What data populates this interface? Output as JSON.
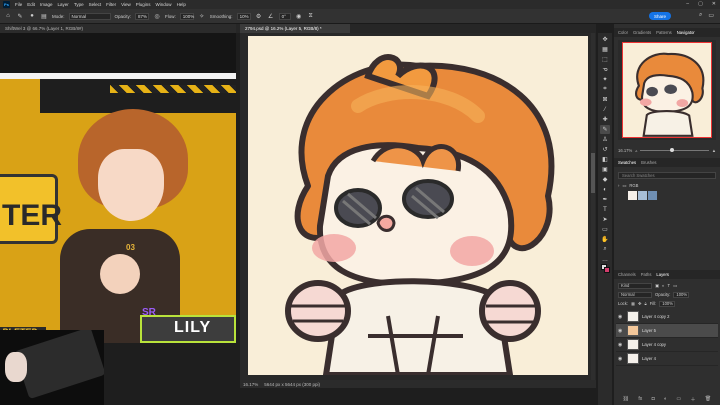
{
  "menubar": {
    "logo": "Ps",
    "items": [
      "File",
      "Edit",
      "Image",
      "Layer",
      "Type",
      "Select",
      "Filter",
      "View",
      "Plugins",
      "Window",
      "Help"
    ]
  },
  "options": {
    "mode_label": "Mode:",
    "mode_value": "Normal",
    "opacity_label": "Opacity:",
    "opacity_value": "87%",
    "flow_label": "Flow:",
    "flow_value": "100%",
    "smoothing_label": "Smoothing:",
    "smoothing_value": "10%",
    "angle_value": "0°",
    "share_label": "Share"
  },
  "tabs": {
    "left_doc": "ShiftWel 3 @ 66.7% (Layer 1, RGB/8#)",
    "main_doc": "2794.psd @ 16.2% (Layer 5, RGB/8) *"
  },
  "left_artwork": {
    "sign_text": "TER",
    "completed_text": "PLETED",
    "name_text": "LILY",
    "rank_text": "SR",
    "top_label": "03"
  },
  "status": {
    "zoom": "16.17%",
    "doc_info": "5644 px x 5644 px (300 ppi)"
  },
  "navigator": {
    "tabs": [
      "Color",
      "Gradients",
      "Patterns",
      "Navigator"
    ],
    "active_tab": "Navigator",
    "zoom": "16.17%"
  },
  "swatches": {
    "tabs": [
      "Swatches",
      "Brushes"
    ],
    "search_placeholder": "Search Swatches",
    "folder_name": "RGB",
    "colors": [
      "#f6f1ea",
      "#a7bed6",
      "#6f8fb3"
    ]
  },
  "layers": {
    "tabs": [
      "Channels",
      "Paths",
      "Layers"
    ],
    "kind_label": "Kind",
    "blend_value": "Normal",
    "opacity_label": "Opacity:",
    "opacity_value": "100%",
    "lock_label": "Lock:",
    "fill_label": "Fill:",
    "fill_value": "100%",
    "items": [
      {
        "name": "Layer 4 copy 2",
        "selected": false
      },
      {
        "name": "Layer 5",
        "selected": true
      },
      {
        "name": "Layer 4 copy",
        "selected": false
      },
      {
        "name": "Layer 4",
        "selected": false
      }
    ]
  },
  "colors": {
    "accent": "#1473e6",
    "hair": "#e98a3b",
    "canvas_bg": "#f9eed8",
    "blush": "#f2a7a4"
  }
}
